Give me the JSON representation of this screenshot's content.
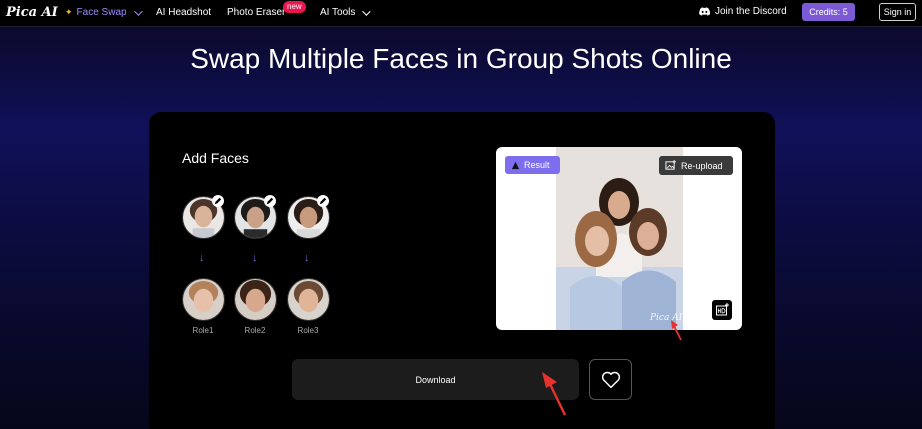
{
  "nav": {
    "logo": "Pica AI",
    "items": [
      {
        "label": "Face Swap",
        "active": true,
        "has_dropdown": true,
        "icon": "sparkle-icon"
      },
      {
        "label": "AI Headshot"
      },
      {
        "label": "Photo Eraser",
        "badge": "new"
      },
      {
        "label": "AI Tools",
        "has_dropdown": true
      }
    ],
    "discord_label": "Join the Discord",
    "credits_label": "Credits: 5",
    "signin_label": "Sign in"
  },
  "page_title": "Swap Multiple Faces in Group Shots Online",
  "add_faces": {
    "heading": "Add Faces",
    "roles": [
      "Role1",
      "Role2",
      "Role3"
    ]
  },
  "result": {
    "tag_label": "Result",
    "reupload_label": "Re-upload",
    "watermark": "Pica AI"
  },
  "actions": {
    "download_label": "Download"
  },
  "colors": {
    "accent_purple": "#7c5ad6",
    "result_tag": "#7d6ef0",
    "new_badge": "#e8174f",
    "annotation_arrow": "#e5322d"
  }
}
